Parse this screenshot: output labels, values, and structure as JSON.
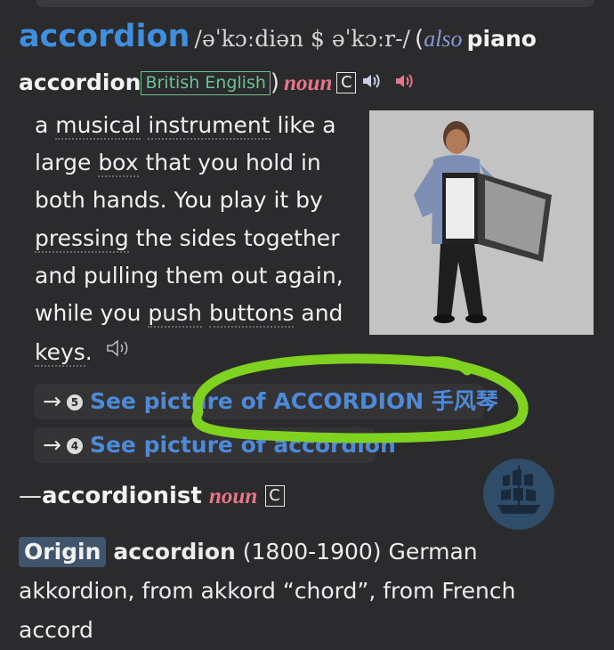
{
  "entry": {
    "headword": "accordion",
    "pronunciation": "/əˈkɔːdiən $ əˈkɔːr-/",
    "paren_open": "(",
    "also_label": "also",
    "alternate": "piano",
    "alternate_2": "accordion",
    "region": "British English",
    "paren_close": ")",
    "pos": "noun",
    "grammar": "C"
  },
  "definition": {
    "parts": [
      "a ",
      "musical",
      " ",
      "instrument",
      " like a large ",
      "box",
      " that you hold in both hands. You play it by ",
      "pressing",
      " the sides together and pulling them out again, while you ",
      "push",
      " ",
      "buttons",
      " and ",
      "keys",
      "."
    ]
  },
  "see_also": [
    {
      "arrow": "→",
      "num": "5",
      "label": "See picture of ACCORDION 手风琴"
    },
    {
      "arrow": "→",
      "num": "4",
      "label": "See picture of accordion"
    }
  ],
  "run_on": {
    "dash": "—",
    "word": "accordionist",
    "pos": "noun",
    "grammar": "C"
  },
  "origin": {
    "label": "Origin",
    "word": "accordion",
    "text": " (1800-1900) German akkordion, from akkord “chord”, from French accord"
  },
  "colors": {
    "background": "#2b2b2d",
    "headword": "#3f8ee0",
    "pos": "#e8768a",
    "region": "#6fc093",
    "highlight": "#7fd320"
  }
}
